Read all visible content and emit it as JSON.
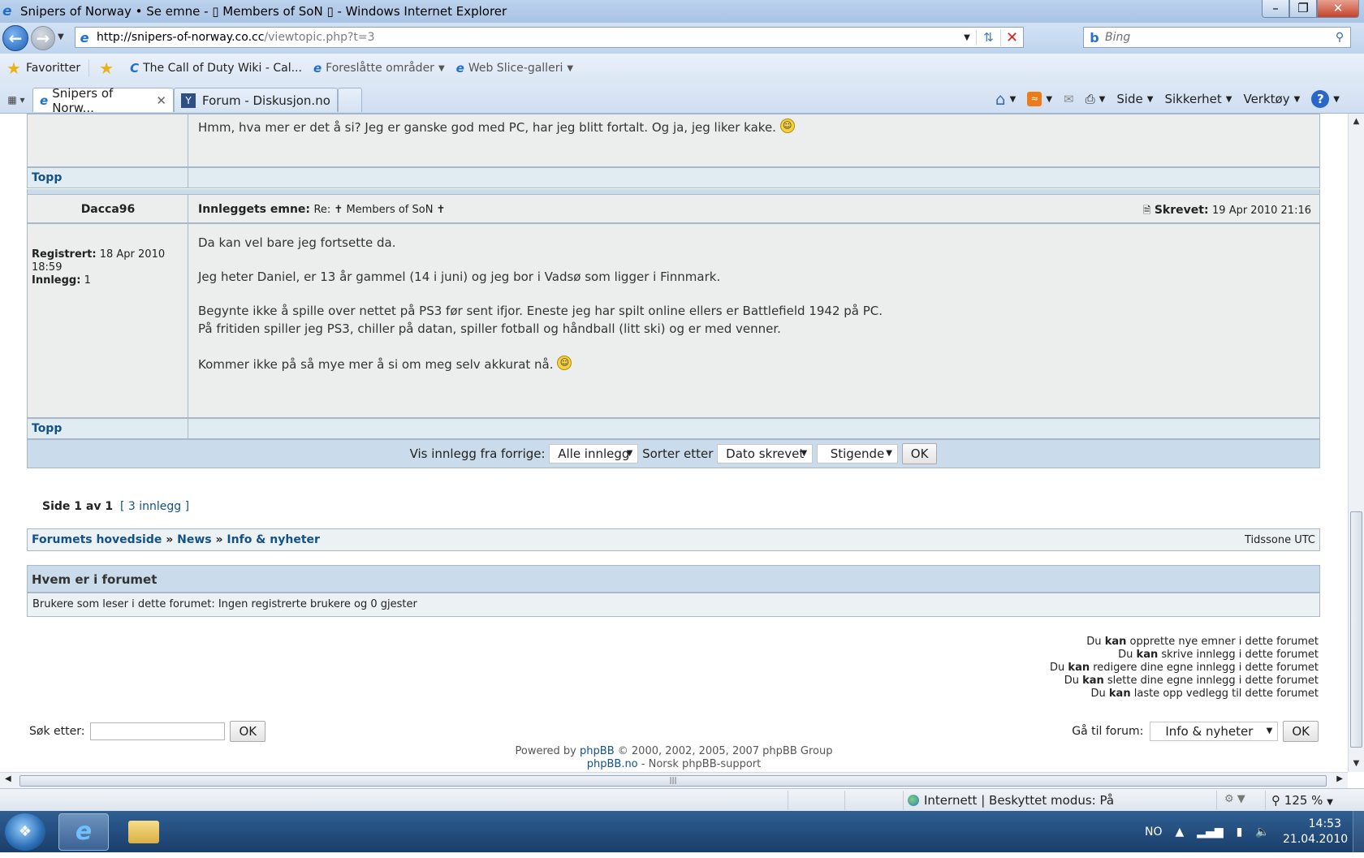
{
  "window": {
    "title": "Snipers of Norway • Se emne - ▯ Members of SoN ▯ - Windows Internet Explorer"
  },
  "address": {
    "url_host": "http://snipers-of-norway.co.cc",
    "url_path": "/viewtopic.php?t=3",
    "search_placeholder": "Bing"
  },
  "favorites": {
    "label": "Favoritter",
    "items": [
      {
        "label": "The Call of Duty Wiki - Cal..."
      },
      {
        "label": "Foreslåtte områder"
      },
      {
        "label": "Web Slice-galleri"
      }
    ]
  },
  "tabs": [
    {
      "label": "Snipers of Norw..."
    },
    {
      "label": "Forum - Diskusjon.no"
    }
  ],
  "commands": {
    "side": "Side",
    "sikkerhet": "Sikkerhet",
    "verktoy": "Verktøy",
    "help": "?"
  },
  "prev_post": {
    "text": "Hmm, hva mer er det å si? Jeg er ganske god med PC, har jeg blitt fortalt. Og ja, jeg liker kake.",
    "top_link": "Topp"
  },
  "post": {
    "author": "Dacca96",
    "subject_label": "Innleggets emne:",
    "subject": "Re: ✝ Members of SoN ✝",
    "written_label": "Skrevet:",
    "written": "19 Apr 2010 21:16",
    "registered_label": "Registrert:",
    "registered_line1": "18 Apr 2010",
    "registered_line2": "18:59",
    "posts_label": "Innlegg:",
    "posts": "1",
    "lines": [
      "Da kan vel bare jeg fortsette da.",
      "Jeg heter Daniel, er 13 år gammel (14 i juni) og jeg bor i Vadsø som ligger i Finnmark.",
      "Begynte ikke å spille over nettet på PS3 før sent ifjor. Eneste jeg har spilt online ellers er Battlefield 1942 på PC.",
      "På fritiden spiller jeg PS3, chiller på datan, spiller fotball og håndball (litt ski) og er med venner.",
      "Kommer ikke på så mye mer å si om meg selv akkurat nå."
    ],
    "top_link": "Topp"
  },
  "sortbar": {
    "show_label": "Vis innlegg fra forrige:",
    "show_value": "Alle innlegg",
    "sort_label": "Sorter etter",
    "sort_value": "Dato skrevet",
    "order_value": "Stigende",
    "ok": "OK"
  },
  "pagination": {
    "page_text": "Side 1 av 1",
    "count_text": "[ 3 innlegg ]"
  },
  "breadcrumb": {
    "items": [
      "Forumets hovedside",
      "News",
      "Info & nyheter"
    ],
    "sep": "»",
    "timezone": "Tidssone UTC"
  },
  "whois": {
    "title": "Hvem er i forumet",
    "text": "Brukere som leser i dette forumet: Ingen registrerte brukere og 0 gjester"
  },
  "permissions": [
    {
      "pre": "Du",
      "kan": "kan",
      "post": "opprette nye emner i dette forumet"
    },
    {
      "pre": "Du",
      "kan": "kan",
      "post": "skrive innlegg i dette forumet"
    },
    {
      "pre": "Du",
      "kan": "kan",
      "post": "redigere dine egne innlegg i dette forumet"
    },
    {
      "pre": "Du",
      "kan": "kan",
      "post": "slette dine egne innlegg i dette forumet"
    },
    {
      "pre": "Du",
      "kan": "kan",
      "post": "laste opp vedlegg til dette forumet"
    }
  ],
  "search": {
    "label": "Søk etter:",
    "ok": "OK"
  },
  "jump": {
    "label": "Gå til forum:",
    "value": "Info & nyheter",
    "ok": "OK"
  },
  "footer": {
    "powered": "Powered by",
    "phpbb": "phpBB",
    "copyright": "© 2000, 2002, 2005, 2007 phpBB Group",
    "phpbbno": "phpBB.no",
    "support": "- Norsk phpBB-support"
  },
  "status": {
    "zone": "Internett | Beskyttet modus: På",
    "zoom": "125 %"
  },
  "taskbar": {
    "lang": "NO",
    "time": "14:53",
    "date": "21.04.2010"
  }
}
